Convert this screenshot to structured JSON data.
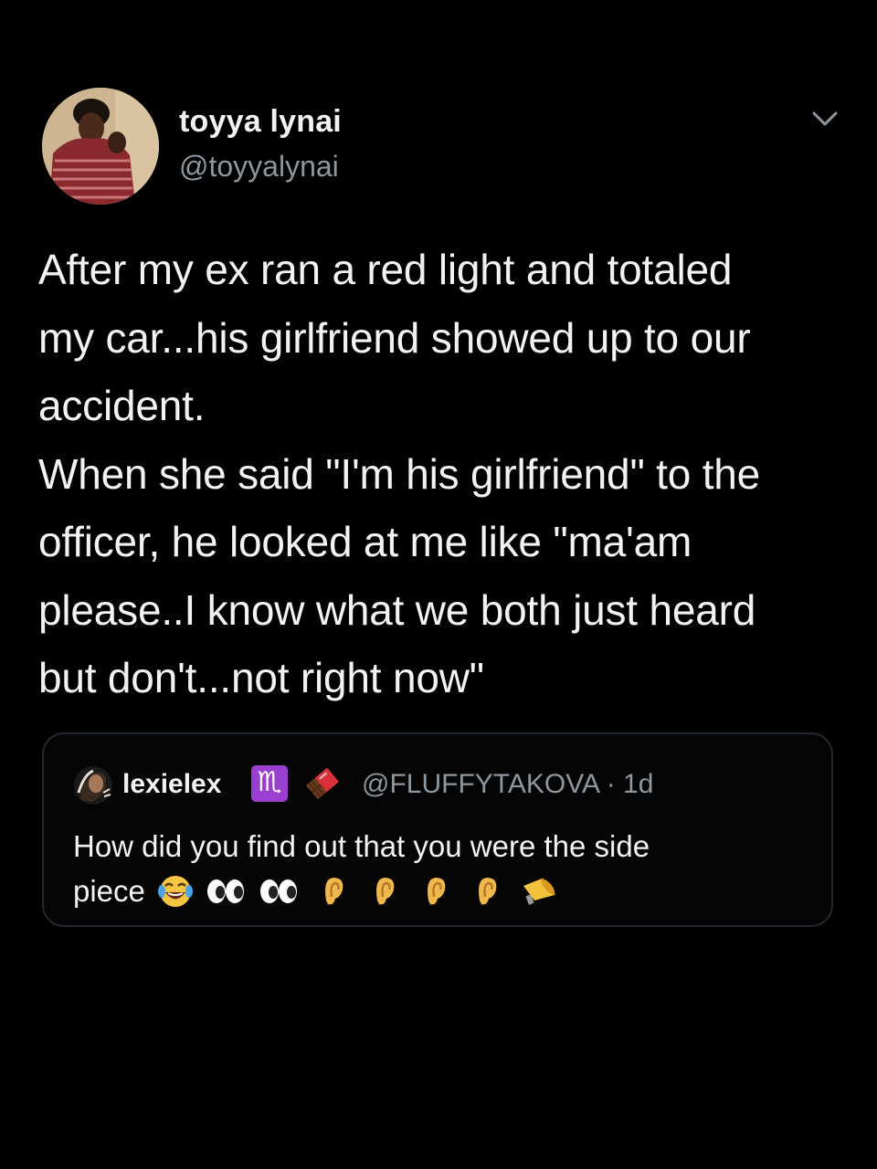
{
  "tweet": {
    "author": {
      "display_name": "toyya lynai",
      "handle": "@toyyalynai",
      "avatar_icon": "profile-photo"
    },
    "menu_icon": "chevron-down-icon",
    "text": "After my ex ran a red light and totaled\nmy car...his girlfriend showed up to our\naccident.\nWhen she said \"I'm his girlfriend\" to the\nofficer, he looked at me like \"ma'am\nplease..I know what we both just heard\nbut don't...not right now\""
  },
  "quoted_tweet": {
    "display_name": "lexielex",
    "name_emojis": [
      "scorpio-icon",
      "chocolate-bar-icon"
    ],
    "scorpio_glyph": "♏",
    "handle": "@FLUFFYTAKOVA",
    "separator": "·",
    "time": "1d",
    "meta": "@FLUFFYTAKOVA · 1d",
    "text_line1": "How did you find out that you were the side",
    "text_line2": "piece",
    "trailing_emojis": [
      "tears-of-joy-icon",
      "eyes-icon",
      "eyes-icon",
      "ear-icon",
      "ear-icon",
      "ear-icon",
      "ear-icon",
      "megaphone-icon"
    ]
  },
  "colors": {
    "background": "#000000",
    "primary_text": "#f2f2f2",
    "secondary_text": "#8f979e",
    "card_border": "#24282c",
    "scorpio_badge": "#9b3fd0"
  }
}
